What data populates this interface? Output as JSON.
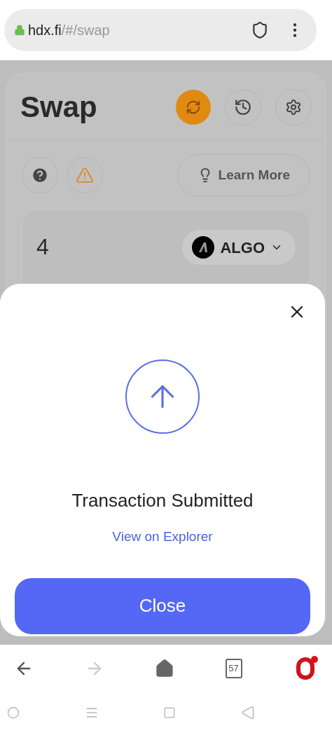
{
  "address_bar": {
    "host": "hdx.fi",
    "path": "/#/swap"
  },
  "swap_card": {
    "title": "Swap",
    "learn_more": "Learn More",
    "amount": "4",
    "token": "ALGO"
  },
  "modal": {
    "title": "Transaction Submitted",
    "link": "View on Explorer",
    "button": "Close"
  },
  "browser_nav": {
    "tab_count": "57"
  }
}
